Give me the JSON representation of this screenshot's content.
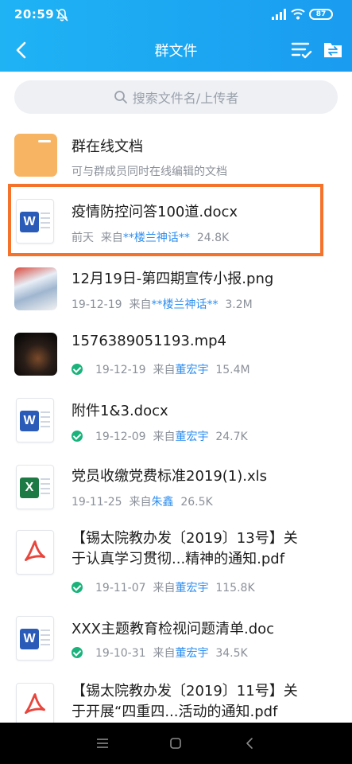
{
  "status": {
    "time": "20:59",
    "battery": "87"
  },
  "nav": {
    "title": "群文件"
  },
  "search": {
    "placeholder": "搜索文件名/上传者"
  },
  "files": [
    {
      "name": "群在线文档",
      "meta": "可与群成员同时在线编辑的文档"
    },
    {
      "name": "疫情防控问答100道.docx",
      "date": "前天",
      "from": "来自",
      "uploader": "**楼兰神话**",
      "size": "24.8K"
    },
    {
      "name": "12月19日-第四期宣传小报.png",
      "date": "19-12-19",
      "from": "来自",
      "uploader": "**楼兰神话**",
      "size": "3.2M"
    },
    {
      "name": "1576389051193.mp4",
      "date": "19-12-19",
      "from": "来自",
      "uploader": "董宏宇",
      "size": "15.4M"
    },
    {
      "name": "附件1&3.docx",
      "date": "19-12-09",
      "from": "来自",
      "uploader": "董宏宇",
      "size": "24.7K"
    },
    {
      "name": "党员收缴党费标准2019(1).xls",
      "date": "19-11-25",
      "from": "来自",
      "uploader": "朱鑫",
      "size": "26.5K"
    },
    {
      "name_line1": "【锡太院教办发〔2019〕13号】关",
      "name_line2": "于认真学习贯彻...精神的通知.pdf",
      "date": "19-11-07",
      "from": "来自",
      "uploader": "董宏宇",
      "size": "115.8K"
    },
    {
      "name": "XXX主题教育检视问题清单.doc",
      "date": "19-10-31",
      "from": "来自",
      "uploader": "董宏宇",
      "size": "34.5K"
    },
    {
      "name_line1": "【锡太院教办发〔2019〕11号】关",
      "name_line2": "于开展“四重四...活动的通知.pdf"
    }
  ],
  "colors": {
    "header": "#1a9cf0",
    "link": "#2d8ef0",
    "highlight": "#f5722b",
    "word": "#2b5bb8",
    "excel": "#1e7a45",
    "pdf": "#e8453c",
    "check": "#19b37b"
  }
}
